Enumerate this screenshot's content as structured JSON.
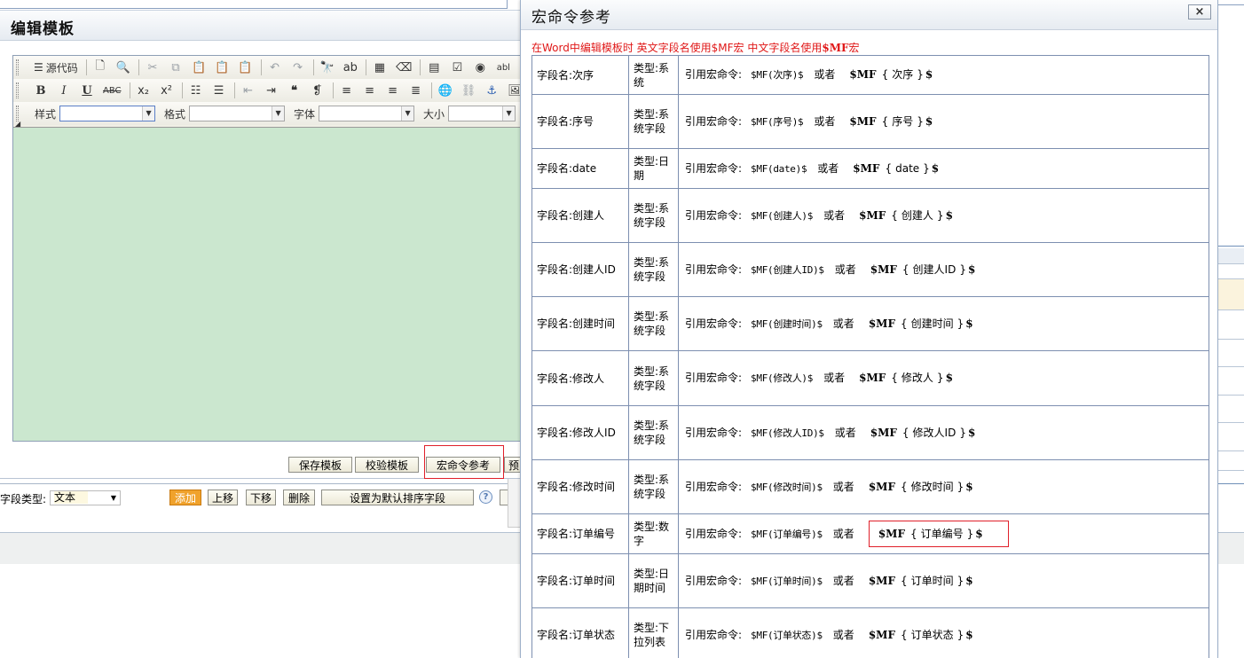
{
  "editor": {
    "title": "编辑模板",
    "toolbar": {
      "source_label": "源代码",
      "style_label": "样式",
      "format_label": "格式",
      "font_label": "字体",
      "size_label": "大小"
    },
    "buttons": {
      "save": "保存模板",
      "check": "校验模板",
      "macro_ref": "宏命令参考",
      "preview": "预"
    }
  },
  "field_panel": {
    "type_label": "字段类型:",
    "type_value": "文本",
    "add": "添加",
    "up": "上移",
    "down": "下移",
    "delete": "删除",
    "set_default_sort": "设置为默认排序字段",
    "help": "?"
  },
  "popup": {
    "title": "宏命令参考",
    "close": "×",
    "note_prefix": "在Word中编辑模板时  英文字段名使用$MF宏  中文字段名使用",
    "note_macro": "$MF",
    "note_suffix": "宏",
    "ref_label": "引用宏命令:",
    "or_label": "或者",
    "rows": [
      {
        "name": "字段名:次序",
        "type": "类型:系统",
        "macro": "$MF(次序)$",
        "alt_field": "次序"
      },
      {
        "name": "字段名:序号",
        "type": "类型:系统字段",
        "macro": "$MF(序号)$",
        "alt_field": "序号"
      },
      {
        "name": "字段名:date",
        "type": "类型:日期",
        "macro": "$MF(date)$",
        "alt_field": "date"
      },
      {
        "name": "字段名:创建人",
        "type": "类型:系统字段",
        "macro": "$MF(创建人)$",
        "alt_field": "创建人"
      },
      {
        "name": "字段名:创建人ID",
        "type": "类型:系统字段",
        "macro": "$MF(创建人ID)$",
        "alt_field": "创建人ID"
      },
      {
        "name": "字段名:创建时间",
        "type": "类型:系统字段",
        "macro": "$MF(创建时间)$",
        "alt_field": "创建时间"
      },
      {
        "name": "字段名:修改人",
        "type": "类型:系统字段",
        "macro": "$MF(修改人)$",
        "alt_field": "修改人"
      },
      {
        "name": "字段名:修改人ID",
        "type": "类型:系统字段",
        "macro": "$MF(修改人ID)$",
        "alt_field": "修改人ID"
      },
      {
        "name": "字段名:修改时间",
        "type": "类型:系统字段",
        "macro": "$MF(修改时间)$",
        "alt_field": "修改时间"
      },
      {
        "name": "字段名:订单编号",
        "type": "类型:数字",
        "macro": "$MF(订单编号)$",
        "alt_field": "订单编号",
        "highlighted": true
      },
      {
        "name": "字段名:订单时间",
        "type": "类型:日期时间",
        "macro": "$MF(订单时间)$",
        "alt_field": "订单时间"
      },
      {
        "name": "字段名:订单状态",
        "type": "类型:下拉列表",
        "macro": "$MF(订单状态)$",
        "alt_field": "订单状态"
      }
    ]
  },
  "colors": {
    "note_red": "#e01818",
    "editor_bg": "#cbe7cf",
    "add_button": "#f0a22c",
    "highlight_border": "#e0202a"
  }
}
